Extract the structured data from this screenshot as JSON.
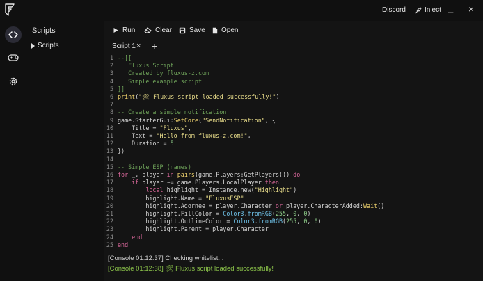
{
  "titlebar": {
    "discord_label": "Discord",
    "inject_label": "Inject",
    "minimize_glyph": "_",
    "close_glyph": "×",
    "icons": [
      "fluxus-logo-icon",
      "syringe-icon"
    ]
  },
  "rail": {
    "icons": [
      "code-icon",
      "gamepad-icon",
      "gear-icon"
    ],
    "accent": "#2b2b35"
  },
  "explorer": {
    "title": "Scripts",
    "items": [
      {
        "label": "Scripts"
      }
    ]
  },
  "toolbar": {
    "run_label": "Run",
    "clear_label": "Clear",
    "save_label": "Save",
    "open_label": "Open"
  },
  "tabs": {
    "items": [
      {
        "label": "Script 1"
      }
    ],
    "close_glyph": "×",
    "add_glyph": "+"
  },
  "editor": {
    "lines": [
      [
        [
          "--[[",
          "com"
        ]
      ],
      [
        [
          "   Fluxus Script",
          "com"
        ]
      ],
      [
        [
          "   Created by fluxus-z.com",
          "com"
        ]
      ],
      [
        [
          "   Simple example script",
          "com"
        ]
      ],
      [
        [
          "]]",
          "com"
        ]
      ],
      [
        [
          "print",
          "fn"
        ],
        [
          "(",
          "var"
        ],
        [
          "\"🛠 Fluxus script loaded successfully!\"",
          "str"
        ],
        [
          ")",
          "var"
        ]
      ],
      [
        [
          "",
          "var"
        ]
      ],
      [
        [
          "-- Create a simple notification",
          "com"
        ]
      ],
      [
        [
          "game.StarterGui:",
          "var"
        ],
        [
          "SetCore",
          "fn"
        ],
        [
          "(",
          "var"
        ],
        [
          "\"SendNotification\"",
          "str"
        ],
        [
          ", {",
          "var"
        ]
      ],
      [
        [
          "    Title = ",
          "var"
        ],
        [
          "\"Fluxus\"",
          "str"
        ],
        [
          ",",
          "var"
        ]
      ],
      [
        [
          "    Text = ",
          "var"
        ],
        [
          "\"Hello from fluxus-z.com!\"",
          "str"
        ],
        [
          ",",
          "var"
        ]
      ],
      [
        [
          "    Duration = ",
          "var"
        ],
        [
          "5",
          "num"
        ]
      ],
      [
        [
          "})",
          "var"
        ]
      ],
      [
        [
          "",
          "var"
        ]
      ],
      [
        [
          "-- Simple ESP (names)",
          "com"
        ]
      ],
      [
        [
          "for",
          "kw"
        ],
        [
          " _, player ",
          "var"
        ],
        [
          "in",
          "kw"
        ],
        [
          " ",
          "var"
        ],
        [
          "pairs",
          "fn"
        ],
        [
          "(game.Players:GetPlayers()) ",
          "var"
        ],
        [
          "do",
          "kw"
        ]
      ],
      [
        [
          "    ",
          "var"
        ],
        [
          "if",
          "kw"
        ],
        [
          " player ~= game.Players.LocalPlayer ",
          "var"
        ],
        [
          "then",
          "kw"
        ]
      ],
      [
        [
          "        ",
          "var"
        ],
        [
          "local",
          "kw"
        ],
        [
          " highlight = Instance.new(",
          "var"
        ],
        [
          "\"Highlight\"",
          "str"
        ],
        [
          ")",
          "var"
        ]
      ],
      [
        [
          "        highlight.",
          "var"
        ],
        [
          "Name",
          "prop"
        ],
        [
          " = ",
          "var"
        ],
        [
          "\"FluxusESP\"",
          "str"
        ]
      ],
      [
        [
          "        highlight.",
          "var"
        ],
        [
          "Adornee",
          "prop"
        ],
        [
          " = player.Character ",
          "var"
        ],
        [
          "or",
          "kw"
        ],
        [
          " player.CharacterAdded:",
          "var"
        ],
        [
          "Wait",
          "fn"
        ],
        [
          "()",
          "var"
        ]
      ],
      [
        [
          "        highlight.",
          "var"
        ],
        [
          "FillColor",
          "prop"
        ],
        [
          " = ",
          "var"
        ],
        [
          "Color3",
          "type"
        ],
        [
          ".",
          "var"
        ],
        [
          "fromRGB",
          "type"
        ],
        [
          "(",
          "var"
        ],
        [
          "255",
          "num"
        ],
        [
          ", ",
          "var"
        ],
        [
          "0",
          "num"
        ],
        [
          ", ",
          "var"
        ],
        [
          "0",
          "num"
        ],
        [
          ")",
          "var"
        ]
      ],
      [
        [
          "        highlight.",
          "var"
        ],
        [
          "OutlineColor",
          "prop"
        ],
        [
          " = ",
          "var"
        ],
        [
          "Color3",
          "type"
        ],
        [
          ".",
          "var"
        ],
        [
          "fromRGB",
          "type"
        ],
        [
          "(",
          "var"
        ],
        [
          "255",
          "num"
        ],
        [
          ", ",
          "var"
        ],
        [
          "0",
          "num"
        ],
        [
          ", ",
          "var"
        ],
        [
          "0",
          "num"
        ],
        [
          ")",
          "var"
        ]
      ],
      [
        [
          "        highlight.",
          "var"
        ],
        [
          "Parent",
          "prop"
        ],
        [
          " = player.Character",
          "var"
        ]
      ],
      [
        [
          "    ",
          "var"
        ],
        [
          "end",
          "kw"
        ]
      ],
      [
        [
          "end",
          "kw"
        ]
      ]
    ]
  },
  "console": {
    "line1": "[Console 01:12:37] Checking whitelist...",
    "line2": "[Console 01:12:38] 🛠 Fluxus script loaded successfully!",
    "line2_color": "#8bc34a"
  }
}
